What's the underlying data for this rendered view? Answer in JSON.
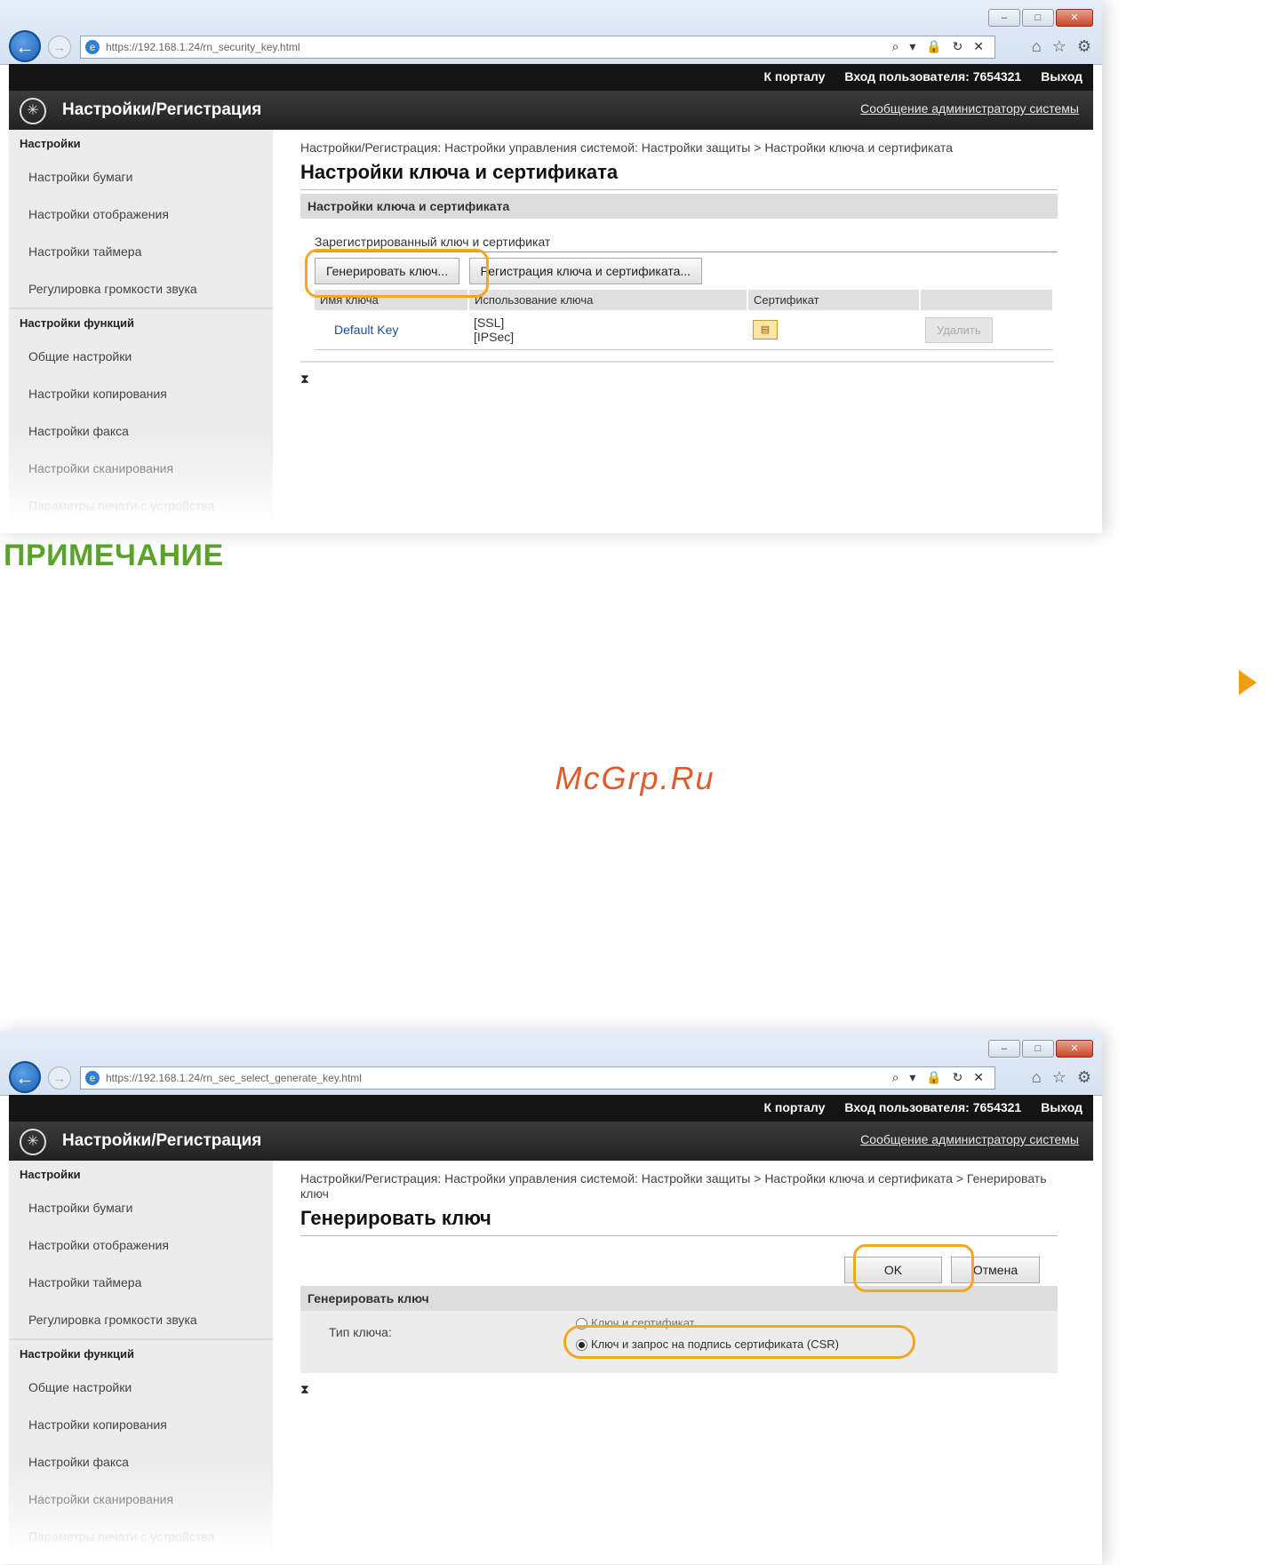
{
  "browser": {
    "url_1": "https://192.168.1.24/rn_security_key.html",
    "url_2": "https://192.168.1.24/rn_sec_select_generate_key.html",
    "address_tools": "⌕ ▾ 🔒 ↻ ✕"
  },
  "header": {
    "device_info": "",
    "portal_link": "К порталу",
    "login_label": "Вход пользователя:",
    "login_user": "7654321",
    "logout": "Выход",
    "app_title": "Настройки/Регистрация",
    "admin_message": "Сообщение администратору системы"
  },
  "sidebar": {
    "section_settings": "Настройки",
    "items_settings": [
      "Настройки бумаги",
      "Настройки отображения",
      "Настройки таймера",
      "Регулировка громкости звука"
    ],
    "section_functions": "Настройки функций",
    "items_functions": [
      "Общие настройки",
      "Настройки копирования",
      "Настройки факса",
      "Настройки сканирования"
    ],
    "item_faded": "Параметры печати с устройства"
  },
  "screen1": {
    "breadcrumb": "Настройки/Регистрация: Настройки управления системой: Настройки защиты > Настройки ключа и сертификата",
    "title": "Настройки ключа и сертификата",
    "section": "Настройки ключа и сертификата",
    "subsection": "Зарегистрированный ключ и сертификат",
    "btn_generate": "Генерировать ключ...",
    "btn_register": "Регистрация ключа и сертификата...",
    "columns": [
      "Имя ключа",
      "Использование ключа",
      "Сертификат",
      ""
    ],
    "row": {
      "name": "Default Key",
      "usage_1": "[SSL]",
      "usage_2": "[IPSec]",
      "delete": "Удалить"
    },
    "to_top": "⧗"
  },
  "note": {
    "title": "ПРИМЕЧАНИЕ"
  },
  "watermark": "McGrp.Ru",
  "screen2": {
    "breadcrumb": "Настройки/Регистрация: Настройки управления системой: Настройки защиты > Настройки ключа и сертификата > Генерировать ключ",
    "title": "Генерировать ключ",
    "ok": "OK",
    "cancel": "Отмена",
    "section": "Генерировать ключ",
    "key_type_label": "Тип ключа:",
    "option_1": "Ключ и сертификат",
    "option_2": "Ключ и запрос на подпись сертификата (CSR)",
    "to_top": "⧗"
  }
}
